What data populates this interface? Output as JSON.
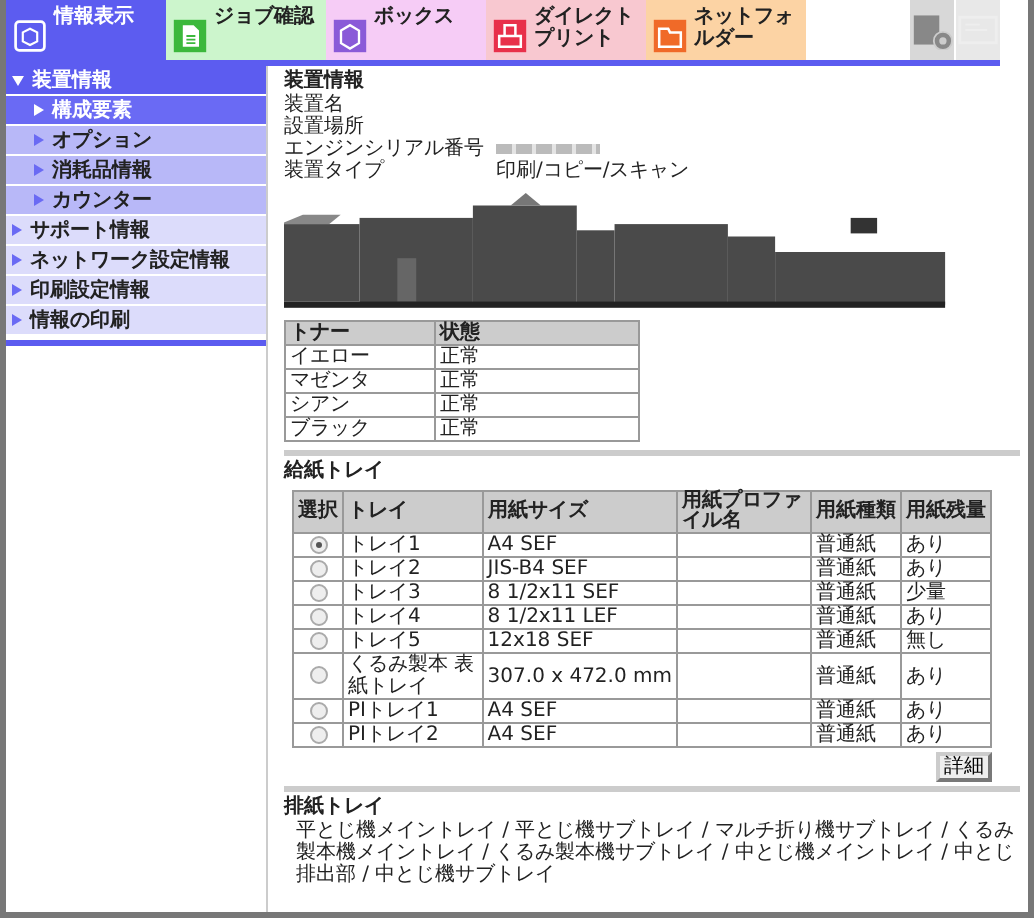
{
  "tabs": [
    {
      "label": "情報表示",
      "selected": true,
      "color": "#5c5cf0",
      "kind": "info"
    },
    {
      "label": "ジョブ確認",
      "selected": false,
      "color": "#ccf5cc",
      "kind": "job"
    },
    {
      "label": "ボックス",
      "selected": false,
      "color": "#f6ccf6",
      "kind": "box"
    },
    {
      "label": "ダイレクトプリント",
      "selected": false,
      "color": "#f8c8d0",
      "kind": "print"
    },
    {
      "label": "ネットフォルダー",
      "selected": false,
      "color": "#fcd3a4",
      "kind": "folder"
    }
  ],
  "toolbar_buttons": [
    {
      "kind": "settings",
      "disabled": false
    },
    {
      "kind": "panel",
      "disabled": true
    }
  ],
  "sidebar": {
    "items": [
      {
        "label": "装置情報",
        "expanded": true,
        "children": [
          {
            "label": "構成要素",
            "selected": true
          },
          {
            "label": "オプション",
            "selected": false
          },
          {
            "label": "消耗品情報",
            "selected": false
          },
          {
            "label": "カウンター",
            "selected": false
          }
        ]
      },
      {
        "label": "サポート情報",
        "expanded": false
      },
      {
        "label": "ネットワーク設定情報",
        "expanded": false
      },
      {
        "label": "印刷設定情報",
        "expanded": false
      },
      {
        "label": "情報の印刷",
        "expanded": false
      }
    ]
  },
  "device_info": {
    "title": "装置情報",
    "fields": [
      {
        "label": "装置名",
        "kind": "text"
      },
      {
        "label": "設置場所",
        "kind": "text"
      },
      {
        "label": "エンジンシリアル番号",
        "kind": "hidden"
      },
      {
        "label": "装置タイプ",
        "kind": "text",
        "value": "印刷/コピー/スキャン"
      }
    ]
  },
  "toner_table": {
    "columns": [
      "トナー",
      "状態"
    ],
    "rows": [
      [
        "イエロー",
        "正常"
      ],
      [
        "マゼンタ",
        "正常"
      ],
      [
        "シアン",
        "正常"
      ],
      [
        "ブラック",
        "正常"
      ]
    ]
  },
  "paper_trays": {
    "title": "給紙トレイ",
    "columns": [
      "選択",
      "トレイ",
      "用紙サイズ",
      "用紙プロファイル名",
      "用紙種類",
      "用紙残量"
    ],
    "rows": [
      {
        "selected": true,
        "cells": [
          "",
          "トレイ1",
          "A4 SEF",
          "",
          "普通紙",
          "あり"
        ]
      },
      {
        "selected": false,
        "cells": [
          "",
          "トレイ2",
          "JIS-B4 SEF",
          "",
          "普通紙",
          "あり"
        ]
      },
      {
        "selected": false,
        "cells": [
          "",
          "トレイ3",
          "8 1/2x11 SEF",
          "",
          "普通紙",
          "少量"
        ]
      },
      {
        "selected": false,
        "cells": [
          "",
          "トレイ4",
          "8 1/2x11 LEF",
          "",
          "普通紙",
          "あり"
        ]
      },
      {
        "selected": false,
        "cells": [
          "",
          "トレイ5",
          "12x18 SEF",
          "",
          "普通紙",
          "無し"
        ]
      },
      {
        "selected": false,
        "cells": [
          "",
          "くるみ製本 表紙トレイ",
          "307.0 x 472.0 mm",
          "",
          "普通紙",
          "あり"
        ]
      },
      {
        "selected": false,
        "cells": [
          "",
          "PIトレイ1",
          "A4 SEF",
          "",
          "普通紙",
          "あり"
        ]
      },
      {
        "selected": false,
        "cells": [
          "",
          "PIトレイ2",
          "A4 SEF",
          "",
          "普通紙",
          "あり"
        ]
      }
    ],
    "detail_button": "詳細"
  },
  "output_trays": {
    "title": "排紙トレイ",
    "text": "平とじ機メイントレイ / 平とじ機サブトレイ / マルチ折り機サブトレイ / くるみ製本機メイントレイ / くるみ製本機サブトレイ / 中とじ機メイントレイ / 中とじ排出部 / 中とじ機サブトレイ"
  }
}
